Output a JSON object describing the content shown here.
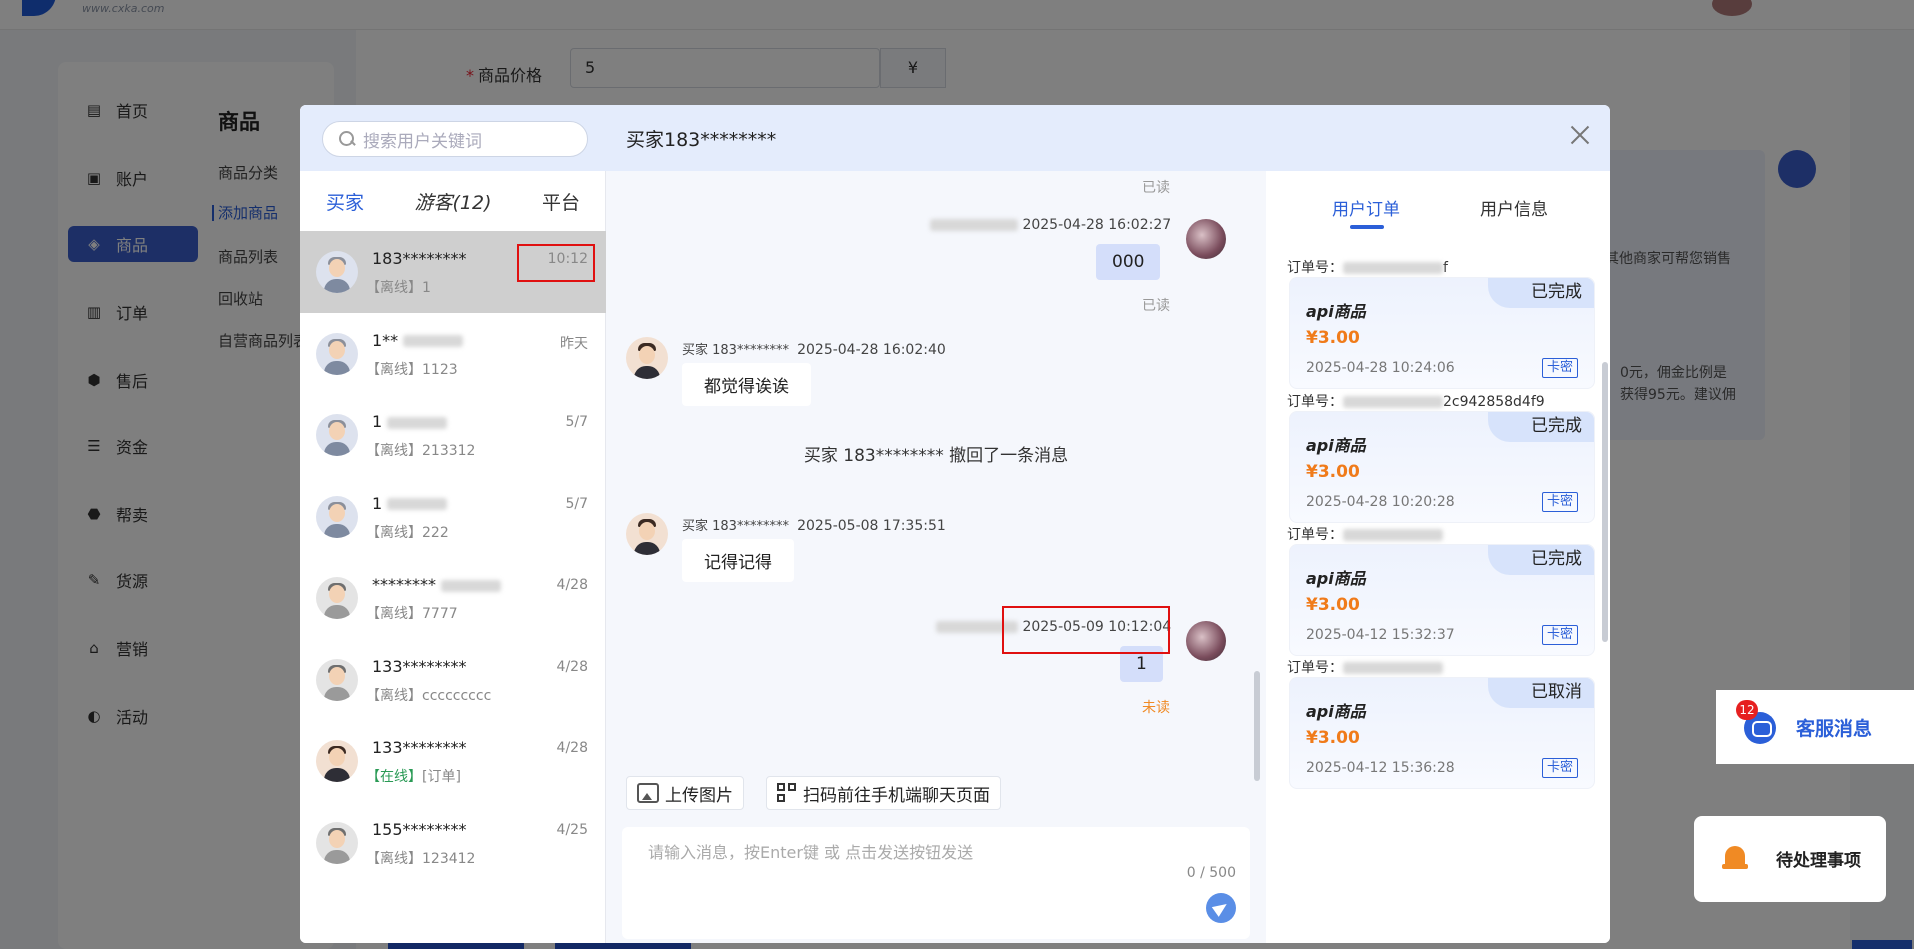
{
  "background": {
    "logo_url": "www.cxka.com",
    "nav": [
      {
        "label": "首页",
        "icon": "home-icon",
        "glyph": "▤"
      },
      {
        "label": "账户",
        "icon": "account-icon",
        "glyph": "▣"
      },
      {
        "label": "商品",
        "icon": "goods-icon",
        "glyph": "◈"
      },
      {
        "label": "订单",
        "icon": "order-icon",
        "glyph": "▥"
      },
      {
        "label": "售后",
        "icon": "after-sale-icon",
        "glyph": "⬢"
      },
      {
        "label": "资金",
        "icon": "funds-icon",
        "glyph": "☰"
      },
      {
        "label": "帮卖",
        "icon": "help-sell-icon",
        "glyph": "⬣"
      },
      {
        "label": "货源",
        "icon": "supply-icon",
        "glyph": "✎"
      },
      {
        "label": "营销",
        "icon": "marketing-icon",
        "glyph": "⌂"
      },
      {
        "label": "活动",
        "icon": "activity-icon",
        "glyph": "◐"
      }
    ],
    "submenu_title": "商品",
    "submenu": [
      "商品分类",
      "添加商品",
      "商品列表",
      "回收站",
      "自营商品列表"
    ],
    "price_label": "商品价格",
    "price_value": "5",
    "price_unit": "¥",
    "card_text_1": "其他商家可帮您销售",
    "card_text_2": "0元，佣金比例是",
    "card_text_3": "获得95元。建议佣"
  },
  "dialog": {
    "search_placeholder": "搜索用户关键词",
    "tabs": [
      "买家",
      "游客(12)",
      "平台"
    ],
    "users": [
      {
        "name": "183********",
        "time": "10:12",
        "status": "【离线】",
        "preview": "1",
        "avatar": "default"
      },
      {
        "name": "1**",
        "time": "昨天",
        "status": "【离线】",
        "preview": "1123",
        "avatar": "default"
      },
      {
        "name": "1",
        "time": "5/7",
        "status": "【离线】",
        "preview": "213312",
        "avatar": "default"
      },
      {
        "name": "1",
        "time": "5/7",
        "status": "【离线】",
        "preview": "222",
        "avatar": "default"
      },
      {
        "name": "********",
        "time": "4/28",
        "status": "【离线】",
        "preview": "7777",
        "avatar": "gray"
      },
      {
        "name": "133********",
        "time": "4/28",
        "status": "【离线】",
        "preview": "ccccccccc",
        "avatar": "gray"
      },
      {
        "name": "133********",
        "time": "4/28",
        "status": "【在线】",
        "preview": "[订单]",
        "avatar": "warm"
      },
      {
        "name": "155********",
        "time": "4/25",
        "status": "【离线】",
        "preview": "123412",
        "avatar": "gray"
      }
    ],
    "chat_title": "买家183********",
    "messages": {
      "read_top": "已读",
      "m1_time": "2025-04-28 16:02:27",
      "m1_text": "000",
      "m1_read": "已读",
      "m2_sender": "买家 183********",
      "m2_time": "2025-04-28 16:02:40",
      "m2_text": "都觉得诶诶",
      "recall": "买家 183******** 撤回了一条消息",
      "m3_sender": "买家 183********",
      "m3_time": "2025-05-08 17:35:51",
      "m3_text": "记得记得",
      "m4_time": "2025-05-09 10:12:04",
      "m4_text": "1",
      "m4_unread": "未读"
    },
    "upload_label": "上传图片",
    "qr_label": "扫码前往手机端聊天页面",
    "input_placeholder": "请输入消息，按Enter键 或 点击发送按钮发送",
    "char_count": "0 / 500",
    "right_tabs": [
      "用户订单",
      "用户信息"
    ],
    "orders": [
      {
        "no_label": "订单号：",
        "no_tail": "f",
        "status": "已完成",
        "product": "api商品",
        "price": "¥3.00",
        "time": "2025-04-28 10:24:06",
        "tag": "卡密"
      },
      {
        "no_label": "订单号：",
        "no_tail": "2c942858d4f9",
        "status": "已完成",
        "product": "api商品",
        "price": "¥3.00",
        "time": "2025-04-28 10:20:28",
        "tag": "卡密"
      },
      {
        "no_label": "订单号：",
        "no_tail": "",
        "status": "已完成",
        "product": "api商品",
        "price": "¥3.00",
        "time": "2025-04-12 15:32:37",
        "tag": "卡密"
      },
      {
        "no_label": "订单号：",
        "no_tail": "",
        "status": "已取消",
        "product": "api商品",
        "price": "¥3.00",
        "time": "2025-04-12 15:36:28",
        "tag": "卡密"
      }
    ]
  },
  "widgets": {
    "cs_badge": "12",
    "cs_label": "客服消息",
    "todo_label": "待处理事项"
  }
}
